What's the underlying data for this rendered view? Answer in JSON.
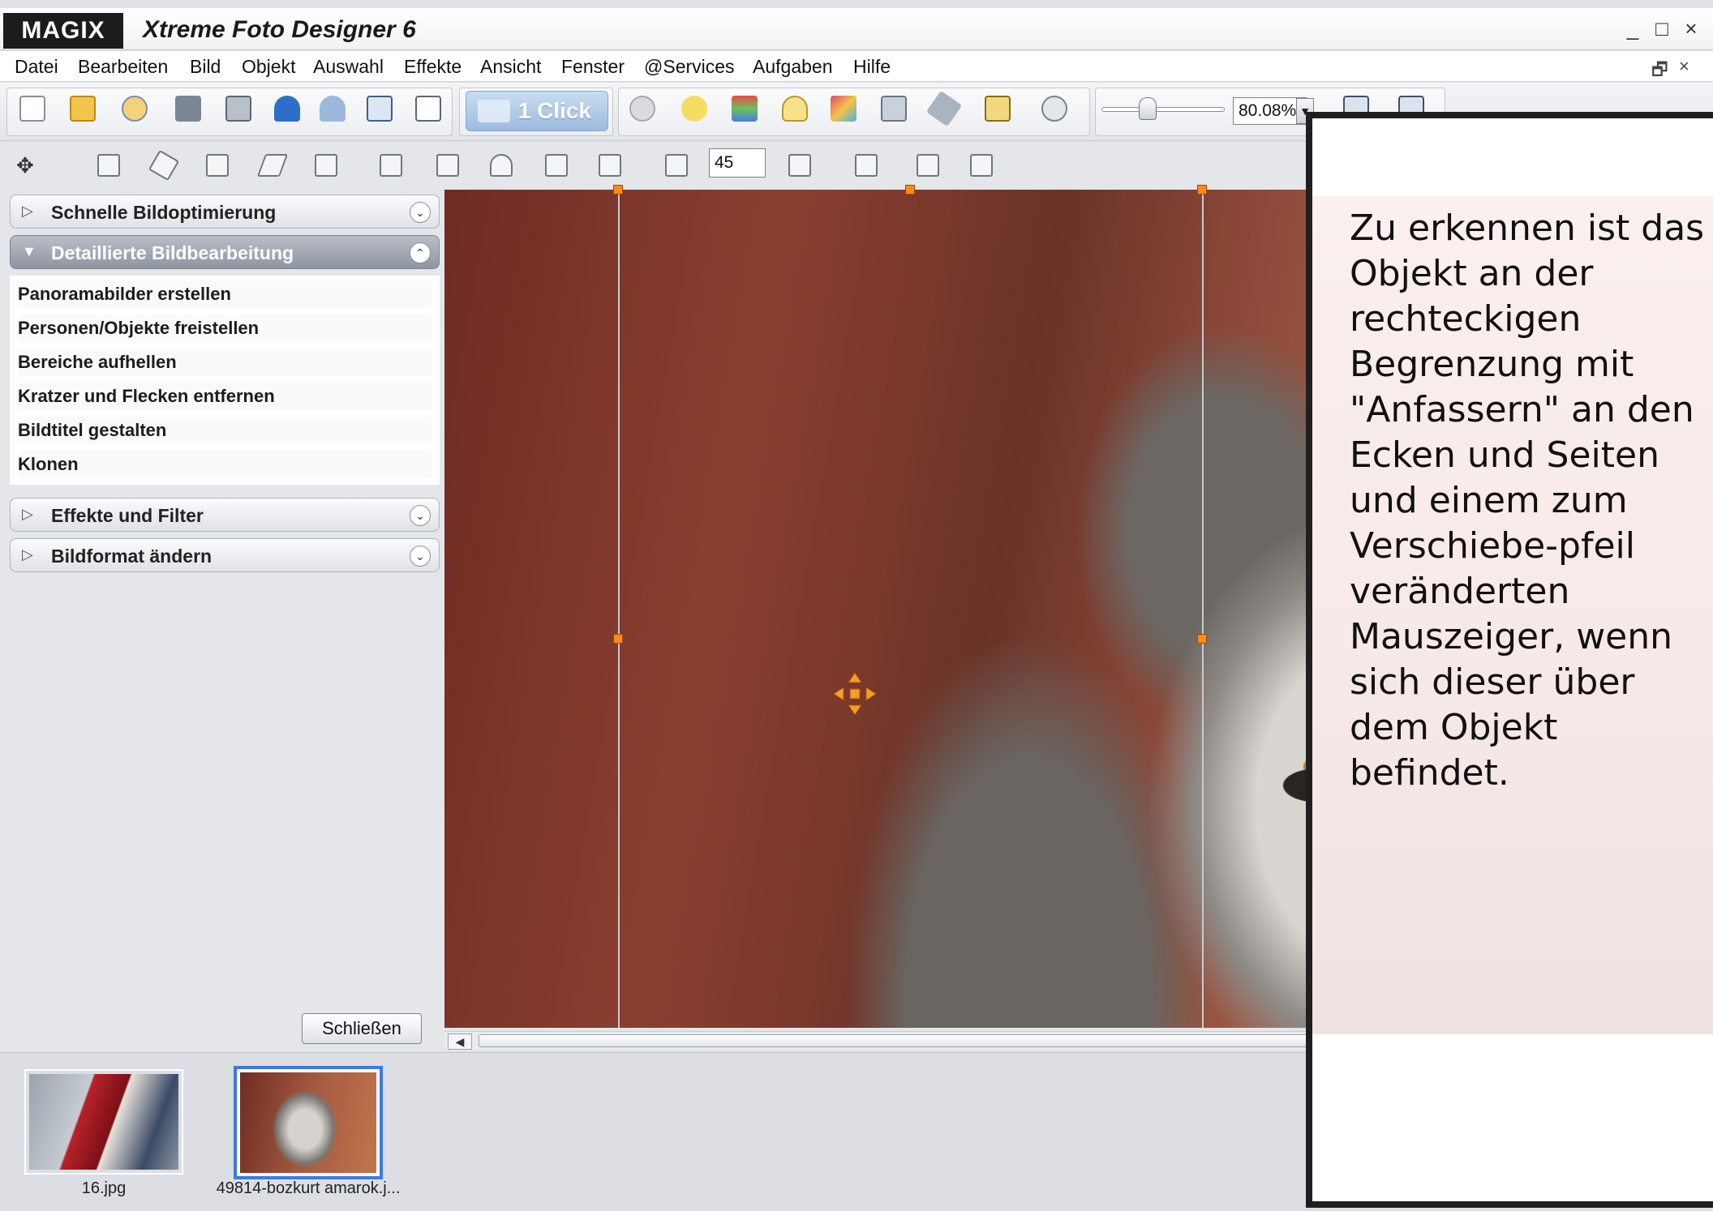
{
  "window": {
    "logo": "MAGIX",
    "title": "Xtreme Foto Designer 6",
    "controls": [
      "_",
      "□",
      "×"
    ]
  },
  "menu": {
    "items": [
      "Datei",
      "Bearbeiten",
      "Bild",
      "Objekt",
      "Auswahl",
      "Effekte",
      "Ansicht",
      "Fenster",
      "@Services",
      "Aufgaben",
      "Hilfe"
    ],
    "mdi_restore": "🗗",
    "mdi_close": "×"
  },
  "toolbar": {
    "one_click_label": "1 Click",
    "zoom_value": "80.08%",
    "zoom_level": 0.35,
    "rotate_angle": "45"
  },
  "left_panel": {
    "sections": [
      {
        "label": "Schnelle Bildoptimierung",
        "expanded": false
      },
      {
        "label": "Detaillierte Bildbearbeitung",
        "expanded": true
      },
      {
        "label": "Effekte und Filter",
        "expanded": false
      },
      {
        "label": "Bildformat ändern",
        "expanded": false
      }
    ],
    "tasks": [
      "Panoramabilder erstellen",
      "Personen/Objekte freistellen",
      "Bereiche aufhellen",
      "Kratzer und Flecken entfernen",
      "Bildtitel gestalten",
      "Klonen"
    ],
    "close_label": "Schließen"
  },
  "thumbnails": [
    {
      "caption": "16.jpg",
      "selected": false
    },
    {
      "caption": "49814-bozkurt amarok.j...",
      "selected": true
    }
  ],
  "annotation": {
    "text": "Zu erkennen ist das Objekt an der rechteckigen Begrenzung mit \"Anfassern\" an den Ecken und Seiten und einem zum Verschiebe-pfeil veränderten Mauszeiger, wenn sich dieser über dem Objekt befindet."
  },
  "colors": {
    "accent": "#3b7ae6",
    "handle": "#ff8a18",
    "panel_bg": "#e4e6ea"
  }
}
